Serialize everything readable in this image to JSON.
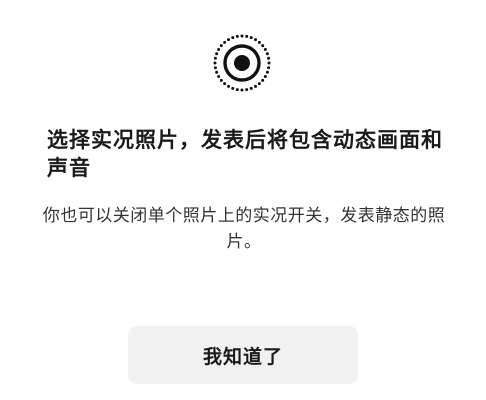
{
  "dialog": {
    "icon": "live-photo-icon",
    "headline": "选择实况照片，发表后将包含动态画面和声音",
    "subtext": "你也可以关闭单个照片上的实况开关，发表静态的照片。",
    "button_label": "我知道了"
  }
}
